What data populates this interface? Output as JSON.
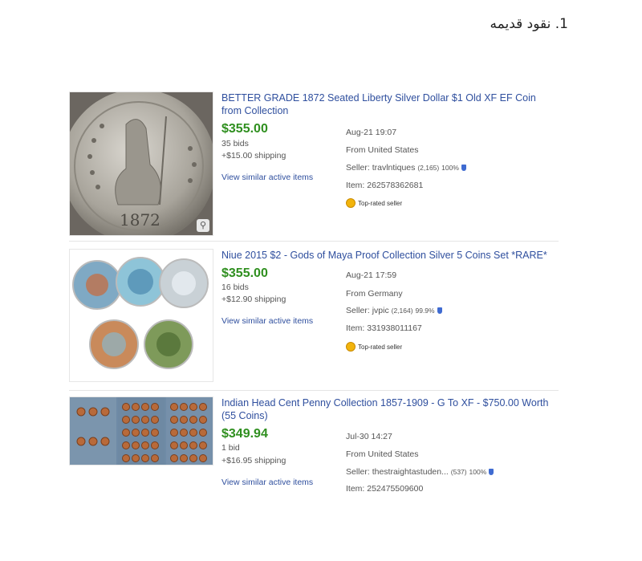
{
  "heading": "1. نقود قديمه",
  "listings": [
    {
      "title": "BETTER GRADE 1872 Seated Liberty Silver Dollar $1 Old XF EF Coin from Collection",
      "price": "$355.00",
      "bids": "35 bids",
      "shipping": "+$15.00 shipping",
      "similar": "View similar active items",
      "end_time": "Aug-21 19:07",
      "location": "From United States",
      "seller_label": "Seller: ",
      "seller_name": "travlntiques",
      "seller_feedback": "(2,165)",
      "seller_pct": "100%",
      "item": "Item: 262578362681",
      "badge": "Top-rated seller",
      "image": "seated-liberty-coin-image"
    },
    {
      "title": "Niue 2015 $2 - Gods of Maya Proof Collection Silver 5 Coins Set *RARE*",
      "price": "$355.00",
      "bids": "16 bids",
      "shipping": "+$12.90 shipping",
      "similar": "View similar active items",
      "end_time": "Aug-21 17:59",
      "location": "From Germany",
      "seller_label": "Seller: ",
      "seller_name": "jvpic",
      "seller_feedback": "(2,164)",
      "seller_pct": "99.9%",
      "item": "Item: 331938011167",
      "badge": "Top-rated seller",
      "image": "maya-coins-set-image"
    },
    {
      "title": "Indian Head Cent Penny Collection 1857-1909 - G To XF - $750.00 Worth (55 Coins)",
      "price": "$349.94",
      "bids": "1 bid",
      "shipping": "+$16.95 shipping",
      "similar": "View similar active items",
      "end_time": "Jul-30 14:27",
      "location": "From United States",
      "seller_label": "Seller: ",
      "seller_name": "thestraightastuden...",
      "seller_feedback": "(537)",
      "seller_pct": "100%",
      "item": "Item: 252475509600",
      "image": "penny-album-image"
    }
  ]
}
